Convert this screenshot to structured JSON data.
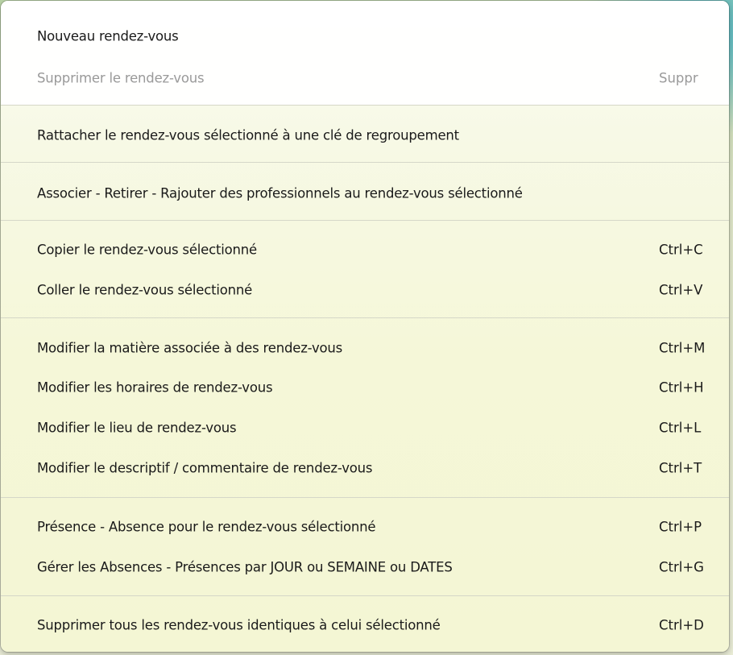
{
  "menu": {
    "items": [
      {
        "label": "Nouveau rendez-vous",
        "shortcut": ""
      },
      {
        "label": "Supprimer le rendez-vous",
        "shortcut": "Suppr"
      },
      {
        "label": "Rattacher le rendez-vous sélectionné à une clé de regroupement",
        "shortcut": ""
      },
      {
        "label": "Associer - Retirer - Rajouter des professionnels au rendez-vous sélectionné",
        "shortcut": ""
      },
      {
        "label": "Copier le rendez-vous sélectionné",
        "shortcut": "Ctrl+C"
      },
      {
        "label": "Coller le rendez-vous sélectionné",
        "shortcut": "Ctrl+V"
      },
      {
        "label": "Modifier la matière associée à des rendez-vous",
        "shortcut": "Ctrl+M"
      },
      {
        "label": "Modifier les horaires de rendez-vous",
        "shortcut": "Ctrl+H"
      },
      {
        "label": "Modifier le lieu de rendez-vous",
        "shortcut": "Ctrl+L"
      },
      {
        "label": "Modifier le descriptif / commentaire de rendez-vous",
        "shortcut": "Ctrl+T"
      },
      {
        "label": "Présence - Absence pour le rendez-vous sélectionné",
        "shortcut": "Ctrl+P"
      },
      {
        "label": "Gérer les Absences - Présences par JOUR ou SEMAINE ou DATES",
        "shortcut": "Ctrl+G"
      },
      {
        "label": "Supprimer tous les rendez-vous identiques à celui sélectionné",
        "shortcut": "Ctrl+D"
      }
    ]
  },
  "colors": {
    "disabled_text": "#9a9a9a",
    "menu_background": "#f5f7d8"
  }
}
